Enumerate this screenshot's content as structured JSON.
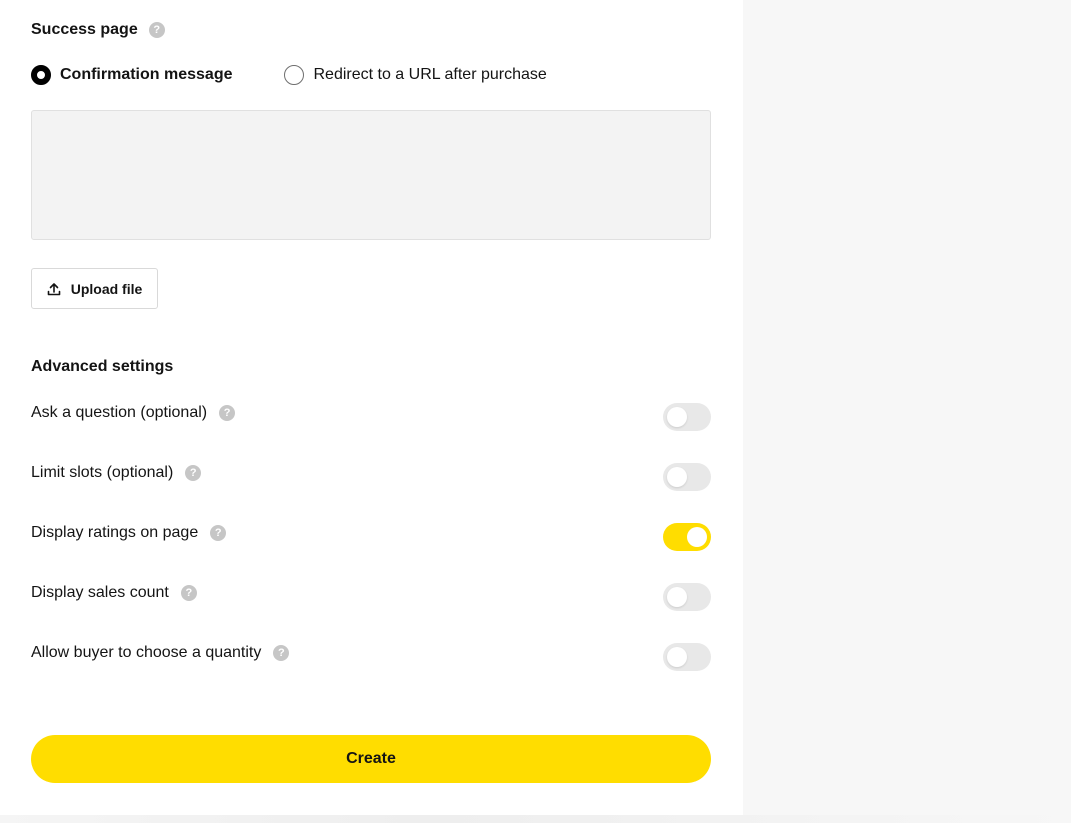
{
  "success_page": {
    "title": "Success page",
    "help_glyph": "?",
    "options": [
      {
        "label": "Confirmation message",
        "selected": true
      },
      {
        "label": "Redirect to a URL after purchase",
        "selected": false
      }
    ],
    "message_value": "",
    "upload_label": "Upload file",
    "upload_icon": "upload-icon"
  },
  "advanced": {
    "title": "Advanced settings",
    "settings": [
      {
        "label": "Ask a question (optional)",
        "enabled": false
      },
      {
        "label": "Limit slots (optional)",
        "enabled": false
      },
      {
        "label": "Display ratings on page",
        "enabled": true
      },
      {
        "label": "Display sales count",
        "enabled": false
      },
      {
        "label": "Allow buyer to choose a quantity",
        "enabled": false
      }
    ]
  },
  "create_label": "Create",
  "colors": {
    "accent": "#ffdd00",
    "toggle_off": "#e8e8e8",
    "help_icon": "#c6c6c6",
    "textarea_bg": "#f3f3f3"
  }
}
